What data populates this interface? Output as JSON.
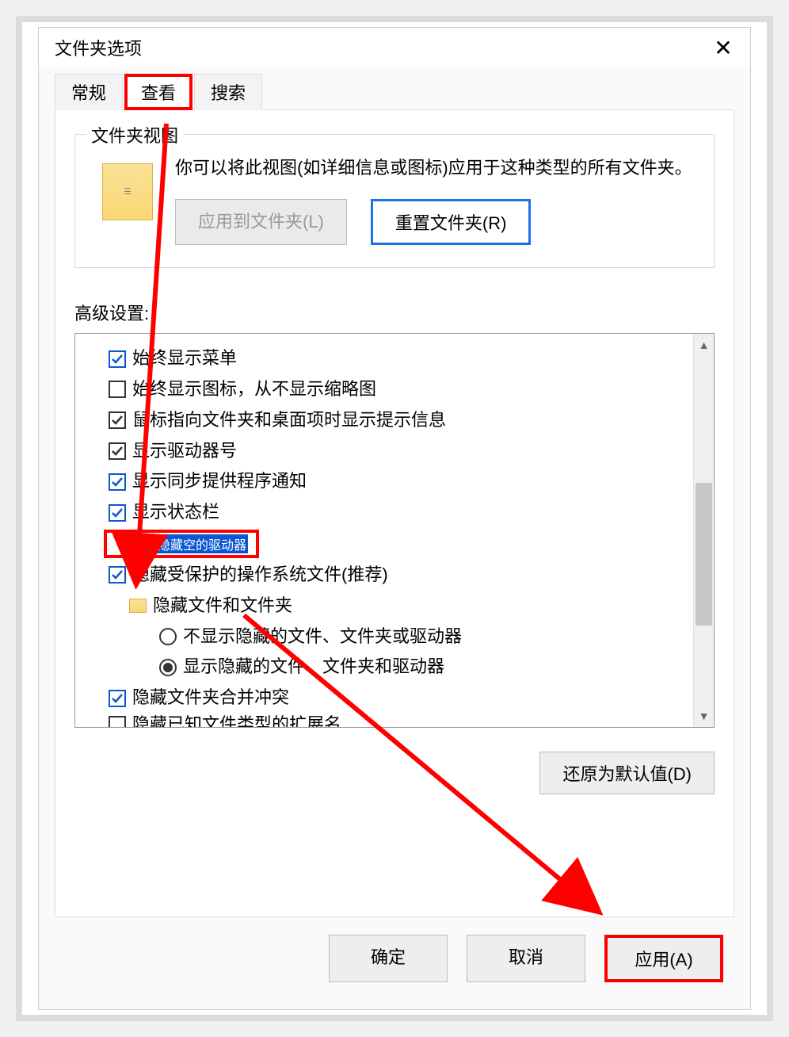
{
  "window": {
    "title": "文件夹选项",
    "close": "✕"
  },
  "tabs": {
    "general": "常规",
    "view": "查看",
    "search": "搜索"
  },
  "folderViews": {
    "legend": "文件夹视图",
    "text": "你可以将此视图(如详细信息或图标)应用于这种类型的所有文件夹。",
    "applyBtn": "应用到文件夹(L)",
    "resetBtn": "重置文件夹(R)"
  },
  "advanced": {
    "label": "高级设置:",
    "items": [
      {
        "type": "check",
        "checked": true,
        "blue": true,
        "label": "始终显示菜单"
      },
      {
        "type": "check",
        "checked": false,
        "label": "始终显示图标，从不显示缩略图"
      },
      {
        "type": "check",
        "checked": true,
        "label": "鼠标指向文件夹和桌面项时显示提示信息"
      },
      {
        "type": "check",
        "checked": true,
        "label": "显示驱动器号"
      },
      {
        "type": "check",
        "checked": true,
        "blue": true,
        "label": "显示同步提供程序通知"
      },
      {
        "type": "check",
        "checked": true,
        "blue": true,
        "label": "显示状态栏"
      },
      {
        "type": "check",
        "checked": false,
        "label": "隐藏空的驱动器",
        "highlight": true,
        "selected": true
      },
      {
        "type": "check",
        "checked": true,
        "blue": true,
        "label": "隐藏受保护的操作系统文件(推荐)"
      },
      {
        "type": "folder",
        "label": "隐藏文件和文件夹",
        "indent": 1
      },
      {
        "type": "radio",
        "checked": false,
        "label": "不显示隐藏的文件、文件夹或驱动器",
        "indent": 2
      },
      {
        "type": "radio",
        "checked": true,
        "label": "显示隐藏的文件、文件夹和驱动器",
        "indent": 2
      },
      {
        "type": "check",
        "checked": true,
        "blue": true,
        "label": "隐藏文件夹合并冲突"
      },
      {
        "type": "check",
        "checked": false,
        "label": "隐藏已知文件类型的扩展名",
        "partial": true
      }
    ],
    "restoreBtn": "还原为默认值(D)"
  },
  "footer": {
    "ok": "确定",
    "cancel": "取消",
    "apply": "应用(A)"
  }
}
